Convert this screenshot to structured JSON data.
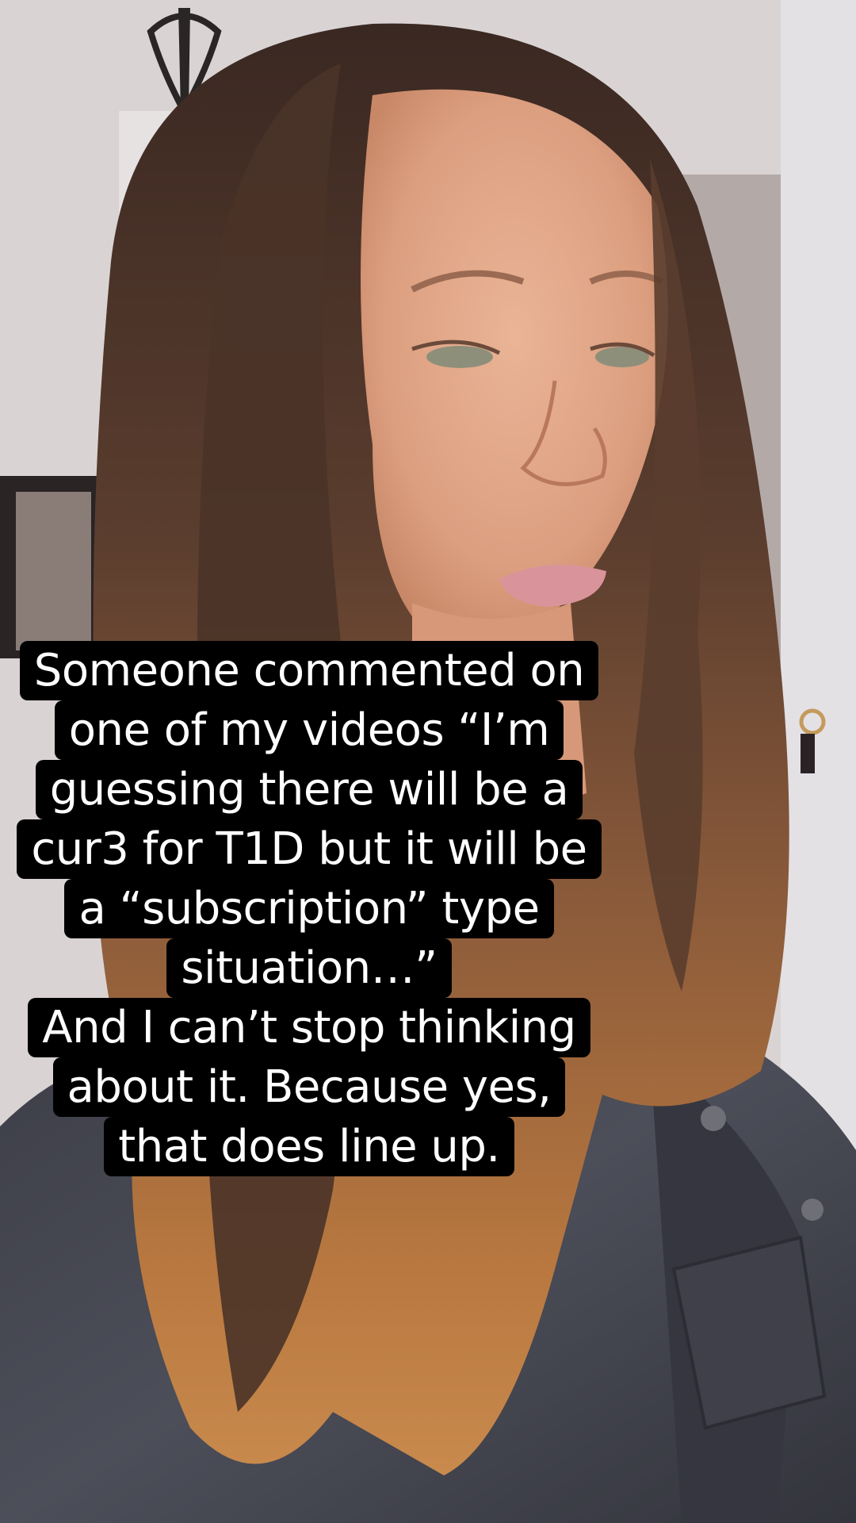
{
  "caption": {
    "lines": [
      "Someone commented on",
      "one of my videos “I’m",
      "guessing there will be a",
      "cur3 for T1D but it will be",
      "a “subscription” type",
      "situation…”",
      "And I can’t stop thinking",
      "about it. Because yes,",
      "that does line up."
    ]
  },
  "colors": {
    "caption_background": "#000000",
    "caption_text": "#ffffff",
    "wall": "#d8d3d2",
    "hair_dark": "#3b2a24",
    "hair_ends": "#b8773f",
    "skin": "#e2a78a",
    "jacket": "#45464f"
  }
}
